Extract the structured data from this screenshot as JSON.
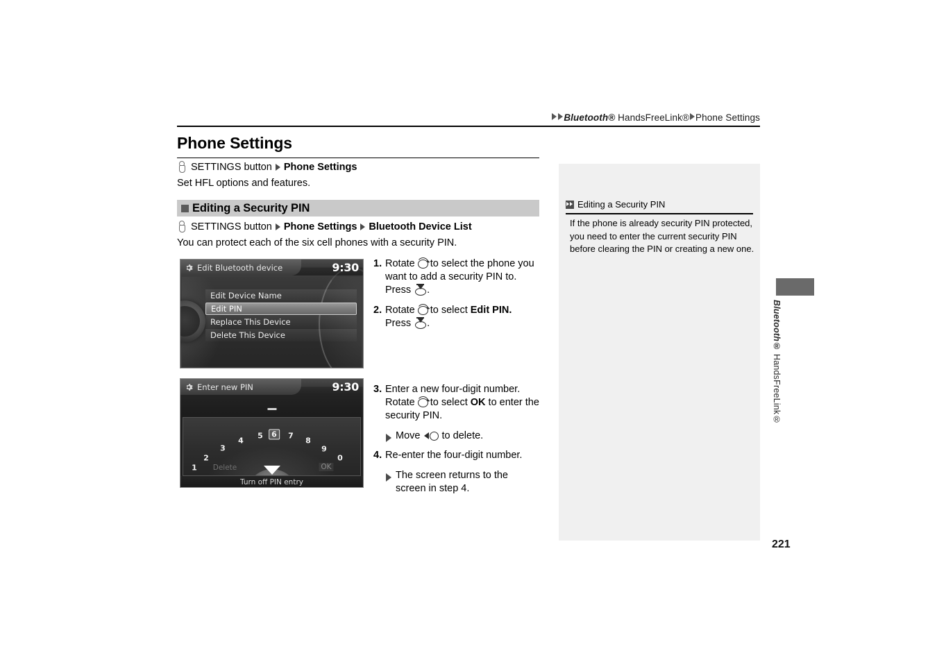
{
  "header": {
    "breadcrumb_1": "Bluetooth®",
    "breadcrumb_2": "HandsFreeLink®",
    "breadcrumb_3": "Phone Settings"
  },
  "page": {
    "title": "Phone Settings",
    "number": "221"
  },
  "nav_primary": {
    "icon": "settings-knob-icon",
    "button_label": "SETTINGS button",
    "target": "Phone Settings"
  },
  "intro_text": "Set HFL options and features.",
  "section": {
    "heading": "Editing a Security PIN",
    "nav": {
      "icon": "settings-knob-icon",
      "button_label": "SETTINGS button",
      "target_1": "Phone Settings",
      "target_2": "Bluetooth Device List"
    },
    "description": "You can protect each of the six cell phones with a security PIN."
  },
  "screenshot_1": {
    "name": "edit-bluetooth-device-screen",
    "title": "Edit Bluetooth device",
    "clock": "9:30",
    "menu": [
      {
        "label": "Edit Device Name",
        "selected": false
      },
      {
        "label": "Edit PIN",
        "selected": true
      },
      {
        "label": "Replace This Device",
        "selected": false
      },
      {
        "label": "Delete This Device",
        "selected": false
      }
    ]
  },
  "screenshot_2": {
    "name": "enter-new-pin-screen",
    "title": "Enter new PIN",
    "clock": "9:30",
    "pin_display": "—",
    "digits": [
      "1",
      "2",
      "3",
      "4",
      "5",
      "6",
      "7",
      "8",
      "9",
      "0"
    ],
    "highlighted_digit": "6",
    "delete_label": "Delete",
    "ok_label": "OK",
    "footer_label": "Turn off PIN entry"
  },
  "steps": [
    {
      "num": "1.",
      "parts": [
        {
          "t": "Rotate "
        },
        {
          "icon": "rotate-knob-icon"
        },
        {
          "t": " to select the phone you want to add a security PIN to. Press "
        },
        {
          "icon": "press-knob-icon"
        },
        {
          "t": "."
        }
      ]
    },
    {
      "num": "2.",
      "parts": [
        {
          "t": "Rotate "
        },
        {
          "icon": "rotate-knob-icon"
        },
        {
          "t": " to select "
        },
        {
          "t": "Edit PIN.",
          "b": true
        },
        {
          "t": " Press "
        },
        {
          "icon": "press-knob-icon"
        },
        {
          "t": "."
        }
      ]
    },
    {
      "num": "3.",
      "parts": [
        {
          "t": "Enter a new four-digit number. Rotate "
        },
        {
          "icon": "rotate-knob-icon"
        },
        {
          "t": " to select "
        },
        {
          "t": "OK",
          "b": true
        },
        {
          "t": " to enter the security PIN."
        }
      ],
      "sub": [
        {
          "parts": [
            {
              "t": "Move "
            },
            {
              "icon": "move-left-icon"
            },
            {
              "t": " to delete."
            }
          ]
        }
      ]
    },
    {
      "num": "4.",
      "parts": [
        {
          "t": "Re-enter the four-digit number."
        }
      ],
      "sub": [
        {
          "parts": [
            {
              "t": "The screen returns to the screen in step 4."
            }
          ]
        }
      ]
    }
  ],
  "step_texts": {
    "s1": "Rotate ROT to select the phone you want to add a security PIN to. Press PRESS.",
    "s1_a": "Rotate",
    "s1_b": "to select the phone you want to add a security PIN to. Press",
    "s2_a": "Rotate",
    "s2_b": "to select",
    "s2_bold": "Edit PIN.",
    "s2_c": "Press",
    "s3_a": "Enter a new four-digit number. Rotate",
    "s3_b": "to select",
    "s3_bold": "OK",
    "s3_c": "to enter the security PIN.",
    "s3_sub_a": "Move",
    "s3_sub_b": "to delete.",
    "s4_a": "Re-enter the four-digit number.",
    "s4_sub": "The screen returns to the screen in step 4.",
    "n1": "1.",
    "n2": "2.",
    "n3": "3.",
    "n4": "4.",
    "period": "."
  },
  "note": {
    "icon": "double-chevron-icon",
    "title": "Editing a Security PIN",
    "body": "If the phone is already security PIN protected, you need to enter the current security PIN before clearing the PIN or creating a new one."
  },
  "side_tab": {
    "label_italic": "Bluetooth®",
    "label_rest": " HandsFreeLink®"
  },
  "colors": {
    "section_bar": "#c9c9c9",
    "note_panel": "#f0f0f0",
    "side_tab": "#6a6a6a",
    "screen_dark": "#2c2c2c"
  }
}
